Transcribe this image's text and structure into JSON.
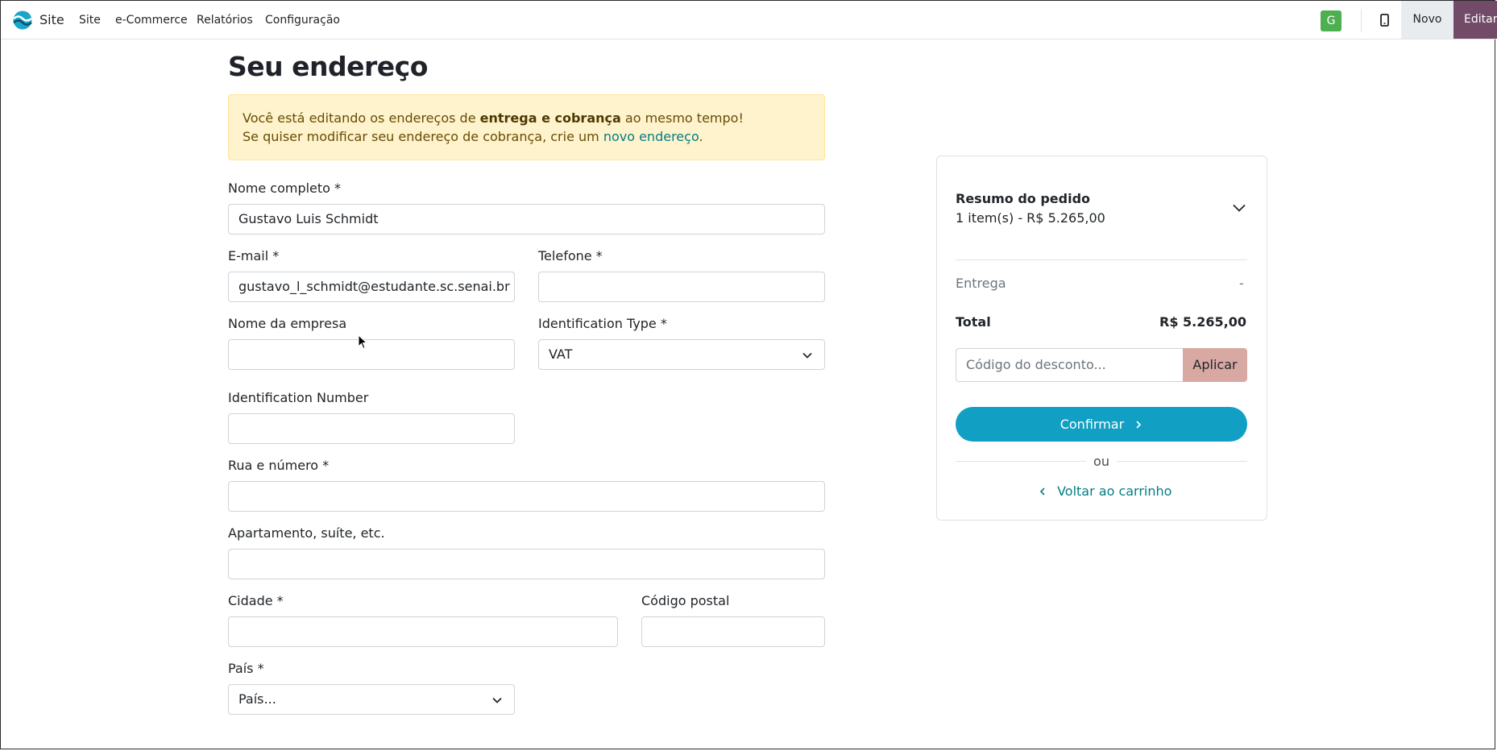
{
  "navbar": {
    "brand": "Site",
    "items": [
      "Site",
      "e-Commerce",
      "Relatórios",
      "Configuração"
    ],
    "avatar_letter": "G",
    "new_label": "Novo",
    "edit_label": "Editar"
  },
  "page": {
    "title": "Seu endereço",
    "alert": {
      "line1_prefix": "Você está editando os endereços de ",
      "line1_bold": "entrega e cobrança",
      "line1_suffix": " ao mesmo tempo!",
      "line2_prefix": "Se quiser modificar seu endereço de cobrança, crie um ",
      "line2_link": "novo endereço",
      "line2_suffix": "."
    },
    "form": {
      "full_name": {
        "label": "Nome completo *",
        "value": "Gustavo Luis Schmidt"
      },
      "email": {
        "label": "E-mail *",
        "value": "gustavo_l_schmidt@estudante.sc.senai.br"
      },
      "phone": {
        "label": "Telefone *",
        "value": ""
      },
      "company": {
        "label": "Nome da empresa",
        "value": ""
      },
      "id_type": {
        "label": "Identification Type *",
        "value": "VAT"
      },
      "id_number": {
        "label": "Identification Number",
        "value": ""
      },
      "street": {
        "label": "Rua e número *",
        "value": ""
      },
      "street2": {
        "label": "Apartamento, suíte, etc.",
        "value": ""
      },
      "city": {
        "label": "Cidade *",
        "value": ""
      },
      "zip": {
        "label": "Código postal",
        "value": ""
      },
      "country": {
        "label": "País *",
        "value": "País..."
      }
    }
  },
  "summary": {
    "title": "Resumo do pedido",
    "items": "1 item(s) -  R$ 5.265,00",
    "shipping_label": "Entrega",
    "shipping_value": "-",
    "total_label": "Total",
    "total_value": "R$ 5.265,00",
    "coupon_placeholder": "Código do desconto...",
    "apply_label": "Aplicar",
    "confirm_label": "Confirmar",
    "or_label": "ou",
    "back_label": "Voltar ao carrinho"
  },
  "colors": {
    "primary": "#11a0c4",
    "editar_bg": "#714b67",
    "alert_bg": "#fff3cd",
    "link": "#017e84",
    "avatar_bg": "#4caf50"
  }
}
